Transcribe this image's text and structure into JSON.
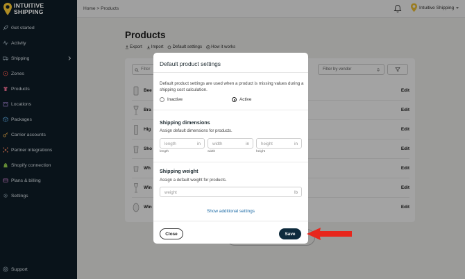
{
  "brand": {
    "name_line1": "INTUITIVE",
    "name_line2": "SHIPPING"
  },
  "sidebar": {
    "items": [
      {
        "label": "Get started",
        "icon": "rocket-icon"
      },
      {
        "label": "Activity",
        "icon": "activity-icon"
      },
      {
        "label": "Shipping",
        "icon": "truck-icon",
        "has_chevron": true
      },
      {
        "label": "Zones",
        "icon": "zones-icon"
      },
      {
        "label": "Products",
        "icon": "shirt-icon"
      },
      {
        "label": "Locations",
        "icon": "building-icon"
      },
      {
        "label": "Packages",
        "icon": "box-icon"
      },
      {
        "label": "Carrier accounts",
        "icon": "key-icon"
      },
      {
        "label": "Partner integrations",
        "icon": "integrations-icon"
      },
      {
        "label": "Shopify connection",
        "icon": "shopify-icon"
      },
      {
        "label": "Plans & billing",
        "icon": "billing-icon"
      },
      {
        "label": "Settings",
        "icon": "gear-icon"
      }
    ],
    "support_label": "Support"
  },
  "topbar": {
    "breadcrumb": "Home > Products",
    "account_name": "Intuitive Shipping"
  },
  "page": {
    "title": "Products",
    "actions": [
      "Export",
      "Import",
      "Default settings",
      "How it works"
    ],
    "filter_placeholder": "Filter",
    "vendor_filter": "Filter by vendor",
    "rows": [
      {
        "name": "Beer",
        "edit": "Edit"
      },
      {
        "name": "Bra",
        "edit": "Edit"
      },
      {
        "name": "Hig",
        "edit": "Edit"
      },
      {
        "name": "Sho",
        "edit": "Edit"
      },
      {
        "name": "Wh",
        "edit": "Edit"
      },
      {
        "name": "Win",
        "edit": "Edit"
      },
      {
        "name": "Win",
        "edit": "Edit"
      }
    ]
  },
  "modal": {
    "title": "Default product settings",
    "description": "Default product settings are used when a product is missing values during a shipping cost calculation.",
    "radio_inactive": "Inactive",
    "radio_active": "Active",
    "selected": "Active",
    "dimensions": {
      "title": "Shipping dimensions",
      "subtitle": "Assign default dimensions for products.",
      "length": {
        "placeholder": "length",
        "unit": "in",
        "caption": "length"
      },
      "width": {
        "placeholder": "width",
        "unit": "in",
        "caption": "width"
      },
      "height": {
        "placeholder": "height",
        "unit": "in",
        "caption": "height"
      }
    },
    "weight": {
      "title": "Shipping weight",
      "subtitle": "Assign a default weight for products.",
      "placeholder": "weight",
      "unit": "lb"
    },
    "more_link": "Show additional settings",
    "close_label": "Close",
    "save_label": "Save"
  },
  "colors": {
    "sidebar_bg": "#0d1b25",
    "brand_yellow": "#f1c232",
    "save_bg": "#0e2b3d",
    "link": "#1b6aa5",
    "arrow": "#e8261c"
  }
}
